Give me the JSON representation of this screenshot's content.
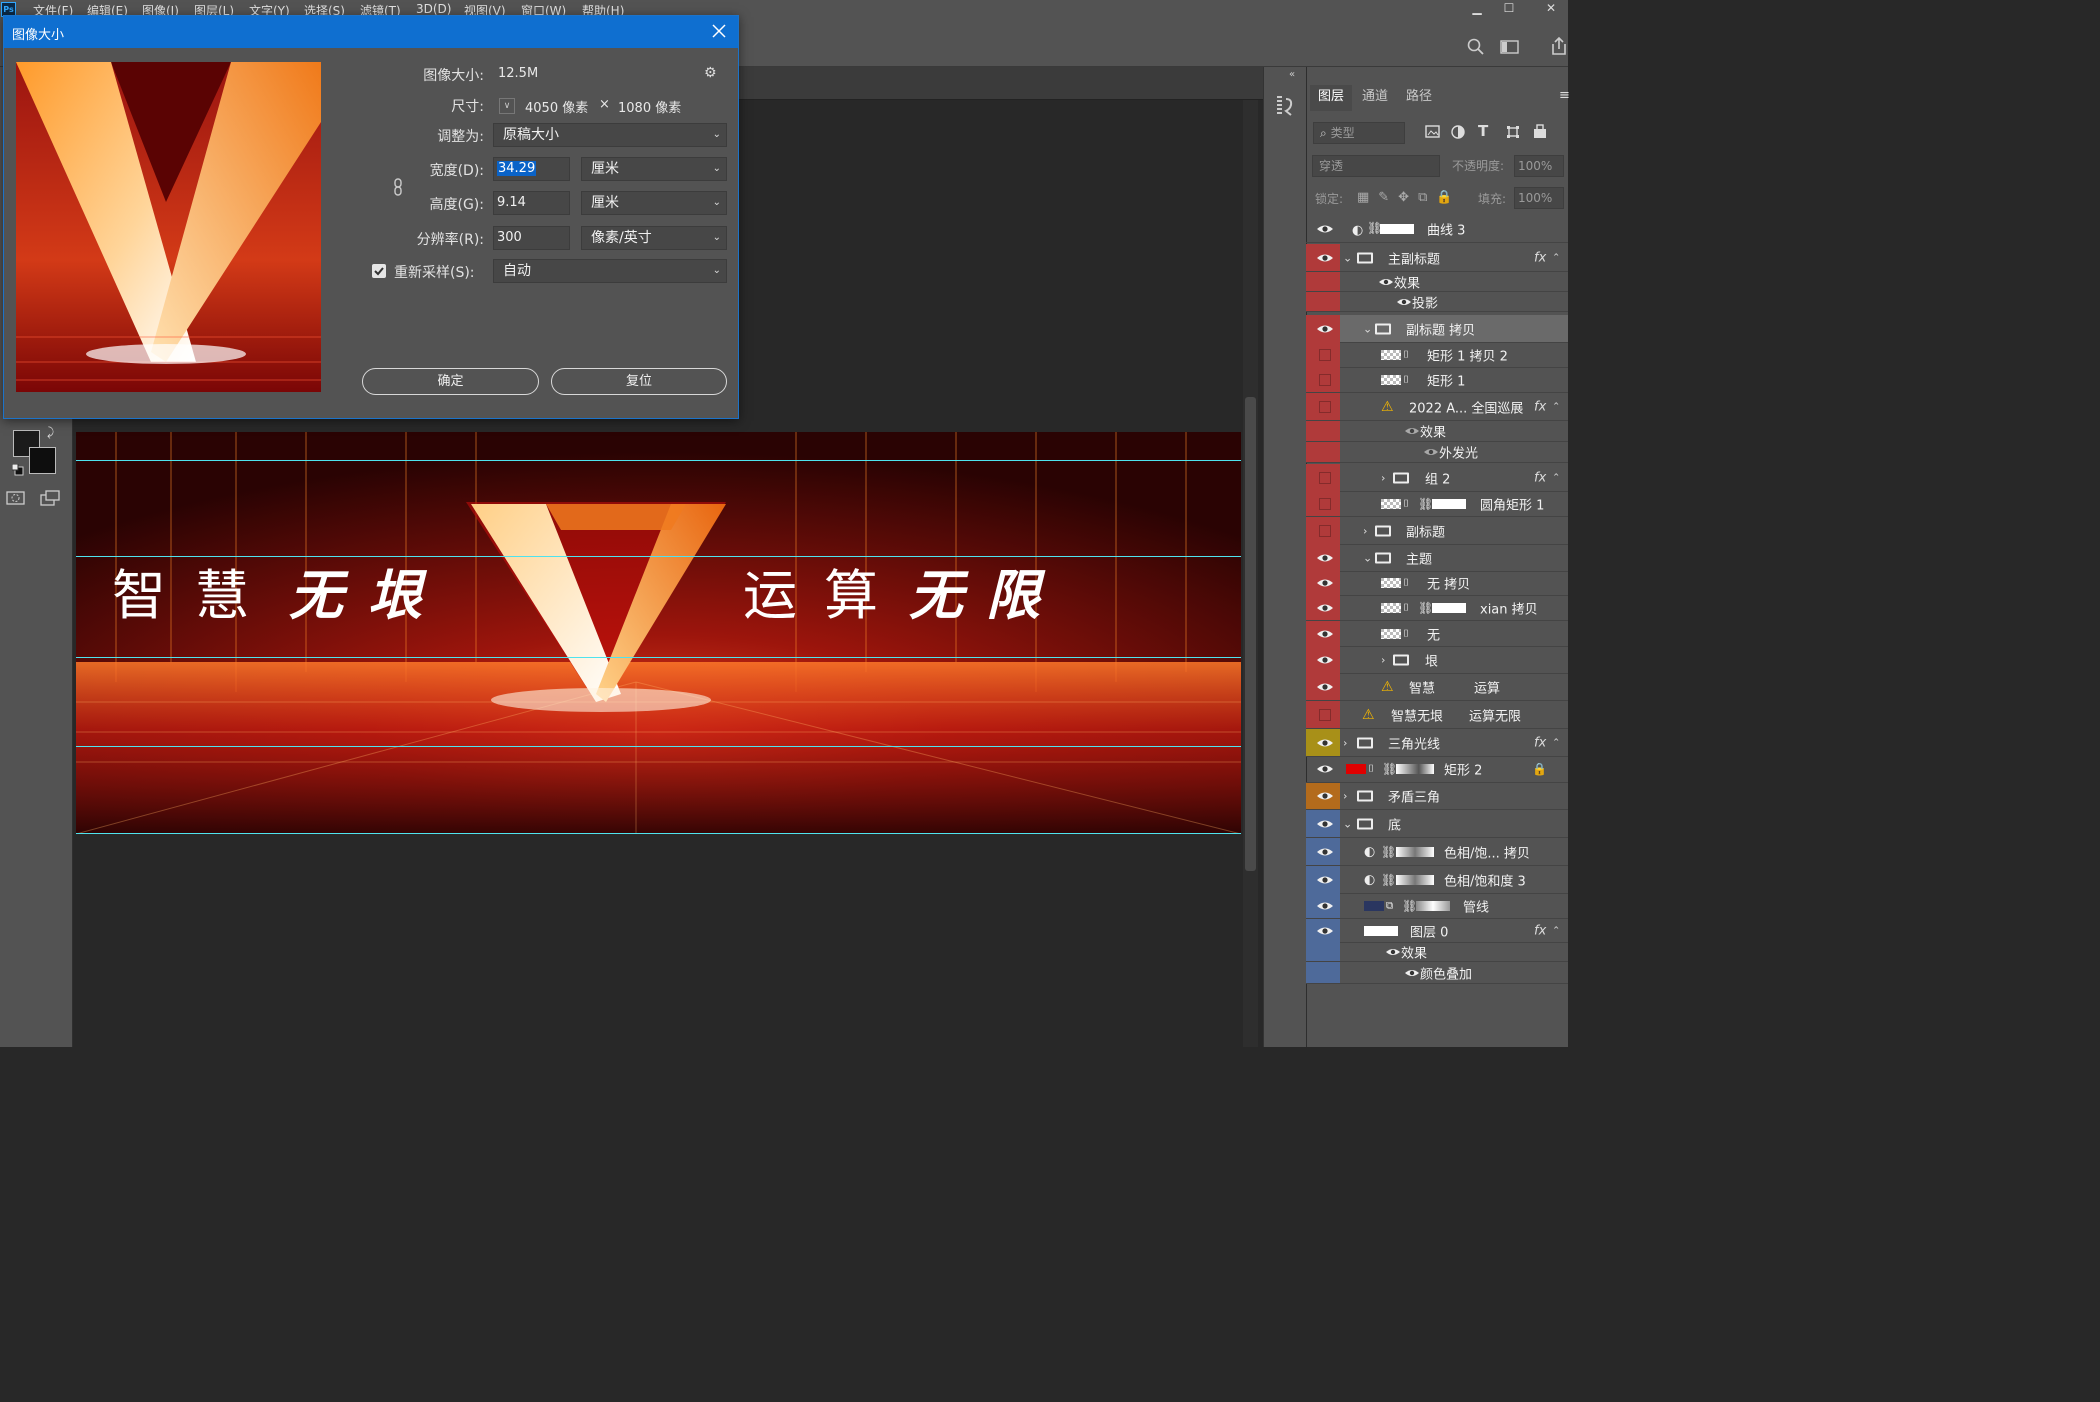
{
  "menubar": {
    "logo": "Ps",
    "items": [
      "文件(F)",
      "编辑(E)",
      "图像(I)",
      "图层(L)",
      "文字(Y)",
      "选择(S)",
      "滤镜(T)",
      "3D(D)",
      "视图(V)",
      "窗口(W)",
      "帮助(H)"
    ]
  },
  "dialog": {
    "title": "图像大小",
    "image_size_label": "图像大小:",
    "image_size_value": "12.5M",
    "dimensions_label": "尺寸:",
    "dim_w": "4050 像素",
    "dim_x": "×",
    "dim_h": "1080 像素",
    "fit_to_label": "调整为:",
    "fit_to_value": "原稿大小",
    "width_label": "宽度(D):",
    "width_value": "34.29",
    "width_unit": "厘米",
    "height_label": "高度(G):",
    "height_value": "9.14",
    "height_unit": "厘米",
    "resolution_label": "分辨率(R):",
    "resolution_value": "300",
    "resolution_unit": "像素/英寸",
    "resample_label": "重新采样(S):",
    "resample_value": "自动",
    "resample_checked": true,
    "ok_button": "确定",
    "reset_button": "复位"
  },
  "canvas": {
    "left_text": [
      "智",
      "慧",
      "无",
      "垠"
    ],
    "right_text": [
      "运",
      "算",
      "无",
      "限"
    ]
  },
  "panel": {
    "tabs": [
      "图层",
      "通道",
      "路径"
    ],
    "filter_placeholder": "类型",
    "blend_mode": "穿透",
    "opacity_label": "不透明度:",
    "opacity_value": "100%",
    "lock_label": "锁定:",
    "fill_label": "填充:",
    "fill_value": "100%",
    "layers": [
      {
        "name": "曲线 3"
      },
      {
        "name": "主副标题"
      },
      {
        "name": "效果"
      },
      {
        "name": "投影"
      },
      {
        "name": "副标题 拷贝"
      },
      {
        "name": "矩形 1 拷贝 2"
      },
      {
        "name": "矩形 1"
      },
      {
        "name": "2022 A... 全国巡展"
      },
      {
        "name": "效果"
      },
      {
        "name": "外发光"
      },
      {
        "name": "组 2"
      },
      {
        "name": "圆角矩形 1"
      },
      {
        "name": "副标题"
      },
      {
        "name": "主题"
      },
      {
        "name": "无 拷贝"
      },
      {
        "name": "xian 拷贝"
      },
      {
        "name": "无"
      },
      {
        "name": "垠"
      },
      {
        "name": "智慧　　　运算"
      },
      {
        "name": "智慧无垠　　运算无限"
      },
      {
        "name": "三角光线"
      },
      {
        "name": "矩形 2"
      },
      {
        "name": "矛盾三角"
      },
      {
        "name": "底"
      },
      {
        "name": "色相/饱... 拷贝"
      },
      {
        "name": "色相/饱和度 3"
      },
      {
        "name": "管线"
      },
      {
        "name": "图层 0"
      },
      {
        "name": "效果"
      },
      {
        "name": "颜色叠加"
      }
    ]
  },
  "colors": {
    "accent": "#0f6fd0",
    "red_tag": "#b03a3a",
    "yellow_tag": "#a89018",
    "orange_tag": "#b36b1c",
    "blue_tag": "#4e6a9a",
    "guide": "#4fe3ee"
  }
}
